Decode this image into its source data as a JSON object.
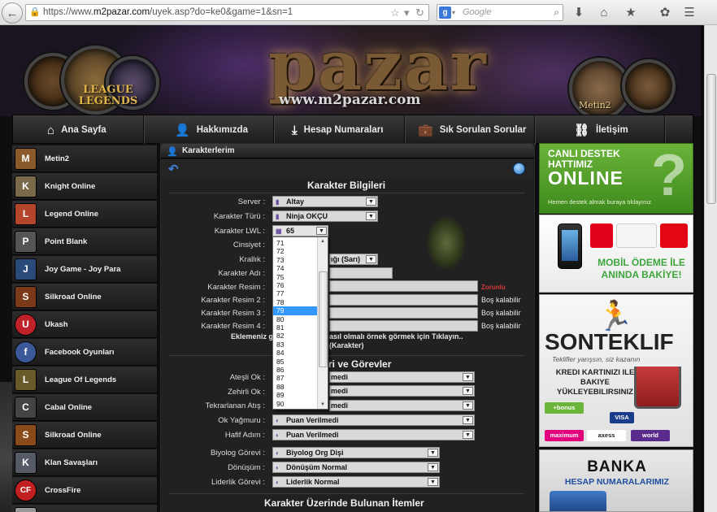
{
  "browser": {
    "url_prefix": "https://www.",
    "url_host": "m2pazar.com",
    "url_path": "/uyek.asp?do=ke0&game=1&sn=1",
    "search_placeholder": "Google",
    "search_engine": "g"
  },
  "banner": {
    "logo_text": "pazar",
    "logo_sub": "www.m2pazar.com",
    "lol_text": "LEAGUE\nLEGENDS",
    "metin_text": "Metin2"
  },
  "nav": [
    {
      "label": "Ana Sayfa",
      "icon": "home-icon",
      "glyph": "⌂"
    },
    {
      "label": "Hakkımızda",
      "icon": "user-icon",
      "glyph": "👤"
    },
    {
      "label": "Hesap Numaraları",
      "icon": "download-icon",
      "glyph": "⤓"
    },
    {
      "label": "Sık Sorulan Sorular",
      "icon": "briefcase-icon",
      "glyph": "💼"
    },
    {
      "label": "İletişim",
      "icon": "link-icon",
      "glyph": "⛓"
    }
  ],
  "sidebar": [
    {
      "label": "Metin2",
      "color": "#8a5a2a",
      "glyph": "M"
    },
    {
      "label": "Knight Online",
      "color": "#7a6a4a",
      "glyph": "K"
    },
    {
      "label": "Legend Online",
      "color": "#b4452a",
      "glyph": "L"
    },
    {
      "label": "Point Blank",
      "color": "#555555",
      "glyph": "P"
    },
    {
      "label": "Joy Game - Joy Para",
      "color": "#2a4a7a",
      "glyph": "J"
    },
    {
      "label": "Silkroad Online",
      "color": "#7a3a1a",
      "glyph": "S"
    },
    {
      "label": "Ukash",
      "color": "#c0222a",
      "glyph": "U"
    },
    {
      "label": "Facebook Oyunları",
      "color": "#3b5998",
      "glyph": "f"
    },
    {
      "label": "League Of Legends",
      "color": "#6a5a2a",
      "glyph": "L"
    },
    {
      "label": "Cabal Online",
      "color": "#444444",
      "glyph": "C"
    },
    {
      "label": "Silkroad Online",
      "color": "#8a4a1a",
      "glyph": "S"
    },
    {
      "label": "Klan Savaşları",
      "color": "#555a66",
      "glyph": "K"
    },
    {
      "label": "CrossFire",
      "color": "#c02020",
      "glyph": "CF"
    }
  ],
  "main": {
    "header": "Karakterlerim",
    "section1_title": "Karakter Bilgileri",
    "section2_title": "ri ve Görevler",
    "section3_title": "Karakter Üzerinde Bulunan İtemler",
    "labels": {
      "server": "Server :",
      "tur": "Karakter Türü :",
      "lwl": "Karakter LWL :",
      "cinsiyet": "Cinsiyet :",
      "krallik": "Krallık :",
      "adi": "Karakter Adı :",
      "resim": "Karakter Resim :",
      "resim2": "Karakter Resim 2 :",
      "resim3": "Karakter Resim 3 :",
      "resim4": "Karakter Resim 4 :",
      "ateşli": "Ateşli Ok :",
      "zehirli": "Zehirli Ok :",
      "tekrar": "Tekrarlanan Atış :",
      "yagmur": "Ok Yağmuru :",
      "hafif": "Hafif Adım :",
      "biyolog": "Biyolog Görevi :",
      "donusum": "Dönüşüm :",
      "liderlik": "Liderlik Görevi :"
    },
    "values": {
      "server": "Altay",
      "tur": "Ninja OKÇU",
      "lwl": "65",
      "krallik": "ığı (Sarı)",
      "ateşli": "medi",
      "zehirli": "medi",
      "tekrar": "medi",
      "yagmur": "Puan Verilmedi",
      "hafif": "Puan Verilmedi",
      "biyolog": "Biyolog Org Dişi",
      "donusum": "Dönüşüm Normal",
      "liderlik": "Liderlik Normal"
    },
    "zorunlu": "Zorunlu",
    "bos1": "Boş kalabilir",
    "bos2": "Boş kalabilir",
    "bos3": "Boş kalabilir",
    "note1": "Eklemeniz g",
    "note2": "asıl olmalı örnek görmek için Tıklayın..",
    "note3": "(Karakter)"
  },
  "dropdown": {
    "options": [
      "71",
      "72",
      "73",
      "74",
      "75",
      "76",
      "77",
      "78",
      "79",
      "80",
      "81",
      "82",
      "83",
      "84",
      "85",
      "86",
      "87",
      "88",
      "89",
      "90"
    ],
    "highlighted": "79"
  },
  "ads": {
    "destek_l1": "CANLI DESTEK HATTIMIZ",
    "destek_l2": "ONLINE",
    "destek_l3": "Hemen destek almak buraya tıklayınız",
    "destek_q": "?",
    "mobil": "MOBİL ÖDEME İLE ANINDA BAKİYE!",
    "sonteklif_brand": "SONTEKLIF",
    "sonteklif_slogan": "Teklifler yarışsın, siz kazanın",
    "sonteklif_kredi": "KREDI KARTINIZI ILE BAKIYE YÜKLEYEBILIRSINIZ",
    "bonus": "+bonus",
    "visa": "VISA",
    "maximum": "maximum",
    "axess": "axess",
    "world": "world",
    "banka_l1": "BANKA",
    "banka_l2": "HESAP NUMARALARIMIZ"
  }
}
